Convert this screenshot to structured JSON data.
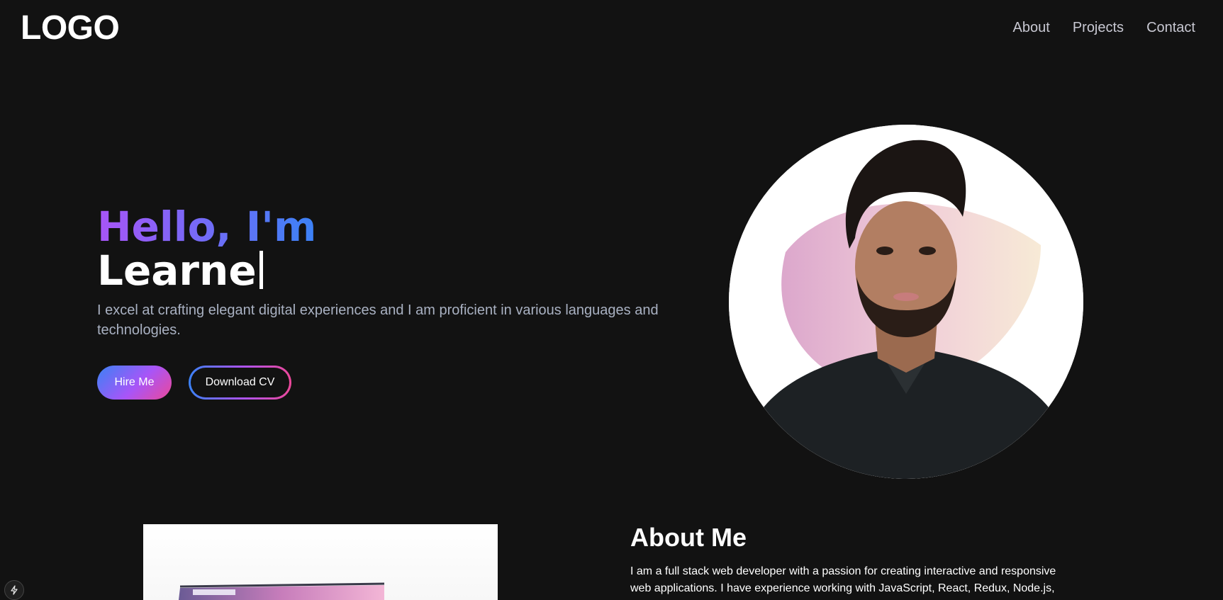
{
  "header": {
    "logo": "LOGO",
    "nav": [
      "About",
      "Projects",
      "Contact"
    ]
  },
  "hero": {
    "greeting": "Hello, I'm",
    "typed_name": "Learne",
    "intro": "I excel at crafting elegant digital experiences and I am proficient in various languages and technologies.",
    "hire_label": "Hire Me",
    "cv_label": "Download CV"
  },
  "about": {
    "title": "About Me",
    "text": "I am a full stack web developer with a passion for creating interactive and responsive web applications. I have experience working with JavaScript, React, Redux, Node.js,"
  },
  "colors": {
    "background": "#121212",
    "gradient_start": "#a855f7",
    "gradient_end": "#3b82f6",
    "accent_pink": "#ec4899"
  },
  "icons": {
    "fab": "lightning-bolt-icon"
  }
}
